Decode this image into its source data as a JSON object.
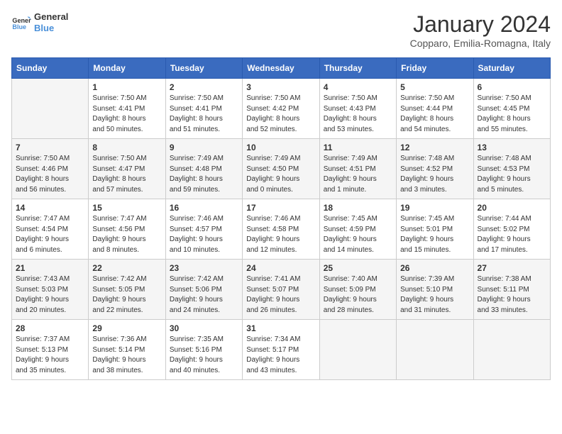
{
  "header": {
    "logo_line1": "General",
    "logo_line2": "Blue",
    "title": "January 2024",
    "subtitle": "Copparo, Emilia-Romagna, Italy"
  },
  "weekdays": [
    "Sunday",
    "Monday",
    "Tuesday",
    "Wednesday",
    "Thursday",
    "Friday",
    "Saturday"
  ],
  "weeks": [
    [
      {
        "num": "",
        "info": ""
      },
      {
        "num": "1",
        "info": "Sunrise: 7:50 AM\nSunset: 4:41 PM\nDaylight: 8 hours\nand 50 minutes."
      },
      {
        "num": "2",
        "info": "Sunrise: 7:50 AM\nSunset: 4:41 PM\nDaylight: 8 hours\nand 51 minutes."
      },
      {
        "num": "3",
        "info": "Sunrise: 7:50 AM\nSunset: 4:42 PM\nDaylight: 8 hours\nand 52 minutes."
      },
      {
        "num": "4",
        "info": "Sunrise: 7:50 AM\nSunset: 4:43 PM\nDaylight: 8 hours\nand 53 minutes."
      },
      {
        "num": "5",
        "info": "Sunrise: 7:50 AM\nSunset: 4:44 PM\nDaylight: 8 hours\nand 54 minutes."
      },
      {
        "num": "6",
        "info": "Sunrise: 7:50 AM\nSunset: 4:45 PM\nDaylight: 8 hours\nand 55 minutes."
      }
    ],
    [
      {
        "num": "7",
        "info": "Sunrise: 7:50 AM\nSunset: 4:46 PM\nDaylight: 8 hours\nand 56 minutes."
      },
      {
        "num": "8",
        "info": "Sunrise: 7:50 AM\nSunset: 4:47 PM\nDaylight: 8 hours\nand 57 minutes."
      },
      {
        "num": "9",
        "info": "Sunrise: 7:49 AM\nSunset: 4:48 PM\nDaylight: 8 hours\nand 59 minutes."
      },
      {
        "num": "10",
        "info": "Sunrise: 7:49 AM\nSunset: 4:50 PM\nDaylight: 9 hours\nand 0 minutes."
      },
      {
        "num": "11",
        "info": "Sunrise: 7:49 AM\nSunset: 4:51 PM\nDaylight: 9 hours\nand 1 minute."
      },
      {
        "num": "12",
        "info": "Sunrise: 7:48 AM\nSunset: 4:52 PM\nDaylight: 9 hours\nand 3 minutes."
      },
      {
        "num": "13",
        "info": "Sunrise: 7:48 AM\nSunset: 4:53 PM\nDaylight: 9 hours\nand 5 minutes."
      }
    ],
    [
      {
        "num": "14",
        "info": "Sunrise: 7:47 AM\nSunset: 4:54 PM\nDaylight: 9 hours\nand 6 minutes."
      },
      {
        "num": "15",
        "info": "Sunrise: 7:47 AM\nSunset: 4:56 PM\nDaylight: 9 hours\nand 8 minutes."
      },
      {
        "num": "16",
        "info": "Sunrise: 7:46 AM\nSunset: 4:57 PM\nDaylight: 9 hours\nand 10 minutes."
      },
      {
        "num": "17",
        "info": "Sunrise: 7:46 AM\nSunset: 4:58 PM\nDaylight: 9 hours\nand 12 minutes."
      },
      {
        "num": "18",
        "info": "Sunrise: 7:45 AM\nSunset: 4:59 PM\nDaylight: 9 hours\nand 14 minutes."
      },
      {
        "num": "19",
        "info": "Sunrise: 7:45 AM\nSunset: 5:01 PM\nDaylight: 9 hours\nand 15 minutes."
      },
      {
        "num": "20",
        "info": "Sunrise: 7:44 AM\nSunset: 5:02 PM\nDaylight: 9 hours\nand 17 minutes."
      }
    ],
    [
      {
        "num": "21",
        "info": "Sunrise: 7:43 AM\nSunset: 5:03 PM\nDaylight: 9 hours\nand 20 minutes."
      },
      {
        "num": "22",
        "info": "Sunrise: 7:42 AM\nSunset: 5:05 PM\nDaylight: 9 hours\nand 22 minutes."
      },
      {
        "num": "23",
        "info": "Sunrise: 7:42 AM\nSunset: 5:06 PM\nDaylight: 9 hours\nand 24 minutes."
      },
      {
        "num": "24",
        "info": "Sunrise: 7:41 AM\nSunset: 5:07 PM\nDaylight: 9 hours\nand 26 minutes."
      },
      {
        "num": "25",
        "info": "Sunrise: 7:40 AM\nSunset: 5:09 PM\nDaylight: 9 hours\nand 28 minutes."
      },
      {
        "num": "26",
        "info": "Sunrise: 7:39 AM\nSunset: 5:10 PM\nDaylight: 9 hours\nand 31 minutes."
      },
      {
        "num": "27",
        "info": "Sunrise: 7:38 AM\nSunset: 5:11 PM\nDaylight: 9 hours\nand 33 minutes."
      }
    ],
    [
      {
        "num": "28",
        "info": "Sunrise: 7:37 AM\nSunset: 5:13 PM\nDaylight: 9 hours\nand 35 minutes."
      },
      {
        "num": "29",
        "info": "Sunrise: 7:36 AM\nSunset: 5:14 PM\nDaylight: 9 hours\nand 38 minutes."
      },
      {
        "num": "30",
        "info": "Sunrise: 7:35 AM\nSunset: 5:16 PM\nDaylight: 9 hours\nand 40 minutes."
      },
      {
        "num": "31",
        "info": "Sunrise: 7:34 AM\nSunset: 5:17 PM\nDaylight: 9 hours\nand 43 minutes."
      },
      {
        "num": "",
        "info": ""
      },
      {
        "num": "",
        "info": ""
      },
      {
        "num": "",
        "info": ""
      }
    ]
  ]
}
